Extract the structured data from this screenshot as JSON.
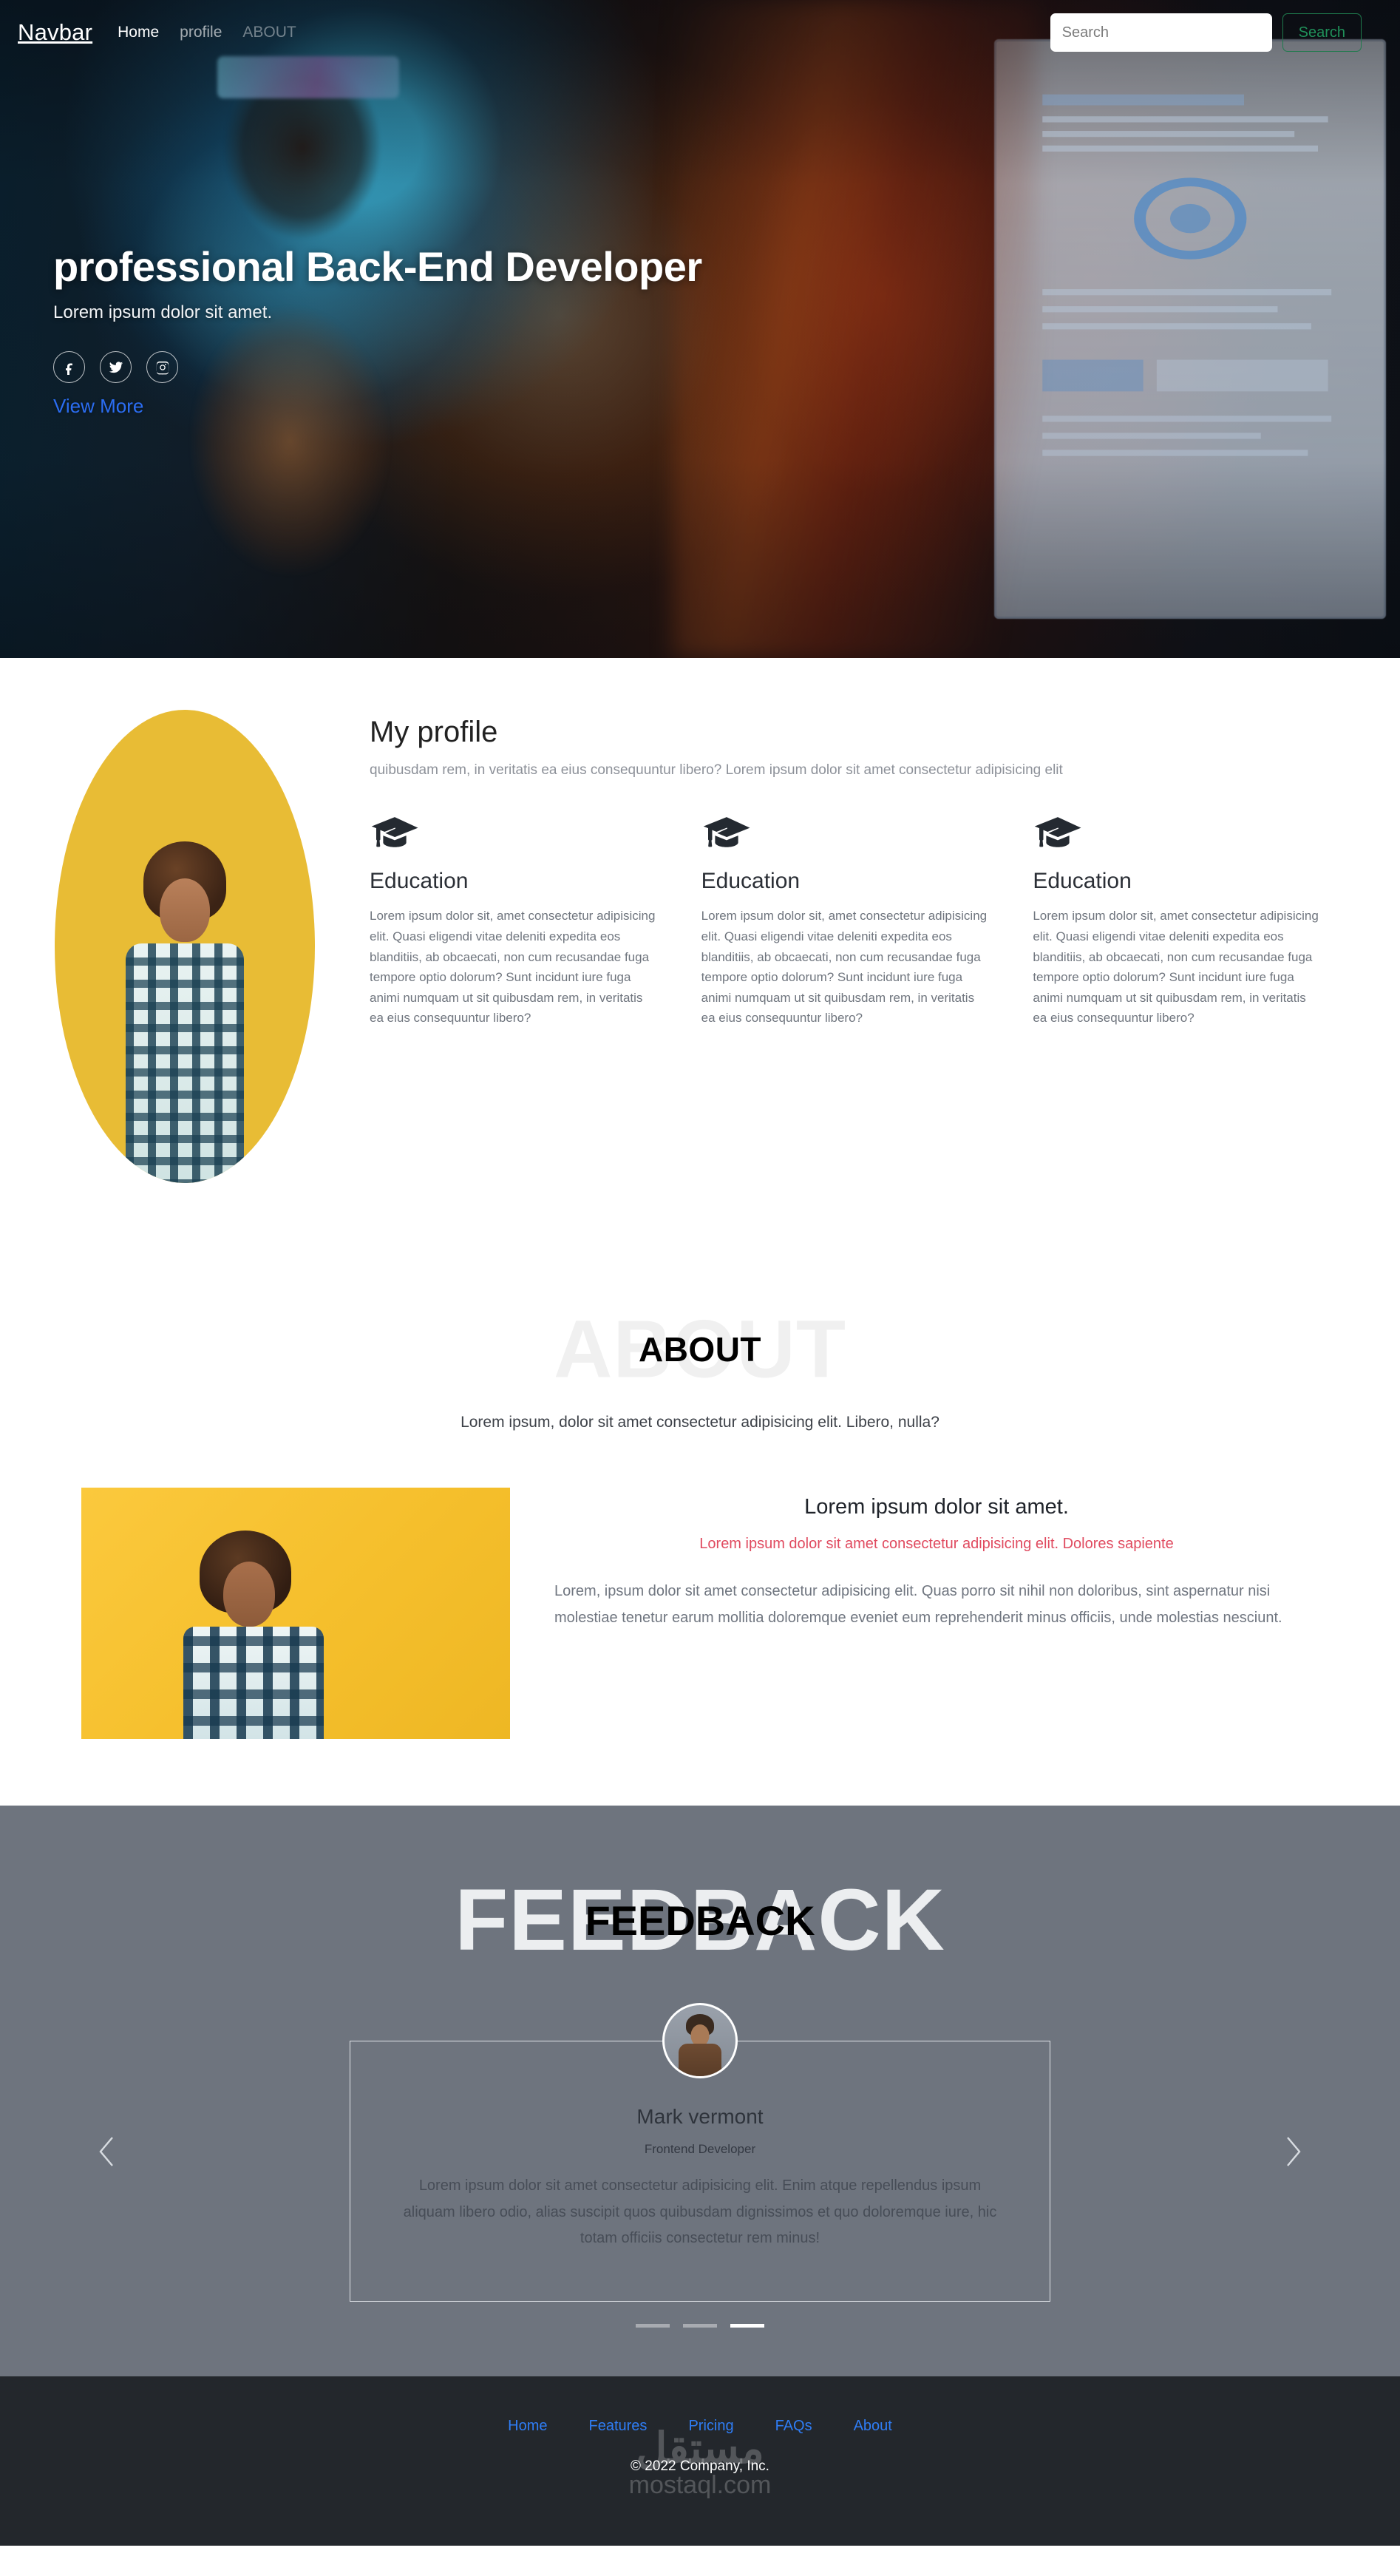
{
  "navbar": {
    "brand": "Navbar",
    "links": [
      {
        "label": "Home",
        "state": "active"
      },
      {
        "label": "profile",
        "state": "normal"
      },
      {
        "label": "ABOUT",
        "state": "muted"
      }
    ],
    "search": {
      "placeholder": "Search",
      "value": "",
      "button_label": "Search",
      "button_color": "#20915a"
    }
  },
  "hero": {
    "title": "professional Back-End Developer",
    "subtitle": "Lorem ipsum dolor sit amet.",
    "socials": [
      {
        "name": "facebook-icon"
      },
      {
        "name": "twitter-icon"
      },
      {
        "name": "instagram-icon"
      }
    ],
    "cta_label": "View More",
    "cta_color": "#2b6df2"
  },
  "profile": {
    "title": "My profile",
    "lead": "quibusdam rem, in veritatis ea eius consequuntur libero? Lorem ipsum dolor sit amet consectetur adipisicing elit",
    "avatar_bg": "#e8bc35",
    "education": [
      {
        "icon": "graduation-cap-icon",
        "title": "Education",
        "body": "Lorem ipsum dolor sit, amet consectetur adipisicing elit. Quasi eligendi vitae deleniti expedita eos blanditiis, ab obcaecati, non cum recusandae fuga tempore optio dolorum? Sunt incidunt iure fuga animi numquam ut sit quibusdam rem, in veritatis ea eius consequuntur libero?"
      },
      {
        "icon": "graduation-cap-icon",
        "title": "Education",
        "body": "Lorem ipsum dolor sit, amet consectetur adipisicing elit. Quasi eligendi vitae deleniti expedita eos blanditiis, ab obcaecati, non cum recusandae fuga tempore optio dolorum? Sunt incidunt iure fuga animi numquam ut sit quibusdam rem, in veritatis ea eius consequuntur libero?"
      },
      {
        "icon": "graduation-cap-icon",
        "title": "Education",
        "body": "Lorem ipsum dolor sit, amet consectetur adipisicing elit. Quasi eligendi vitae deleniti expedita eos blanditiis, ab obcaecati, non cum recusandae fuga tempore optio dolorum? Sunt incidunt iure fuga animi numquam ut sit quibusdam rem, in veritatis ea eius consequuntur libero?"
      }
    ]
  },
  "about": {
    "heading_back": "ABOUT",
    "heading_front": "ABOUT",
    "lead": "Lorem ipsum, dolor sit amet consectetur adipisicing elit. Libero, nulla?",
    "image_bg": "#f5bf2c",
    "title": "Lorem ipsum dolor sit amet.",
    "subtitle": "Lorem ipsum dolor sit amet consectetur adipisicing elit. Dolores sapiente",
    "subtitle_color": "#e04a5f",
    "paragraph": "Lorem, ipsum dolor sit amet consectetur adipisicing elit. Quas porro sit nihil non doloribus, sint aspernatur nisi molestiae tenetur earum mollitia doloremque eveniet eum reprehenderit minus officiis, unde molestias nesciunt."
  },
  "feedback": {
    "heading_back": "FEEDBACK",
    "heading_front": "FEEDBACK",
    "section_bg": "#6e747e",
    "prev_label": "‹",
    "next_label": "›",
    "testimonial": {
      "name": "Mark vermont",
      "role": "Frontend Developer",
      "quote": "Lorem ipsum dolor sit amet consectetur adipisicing elit. Enim atque repellendus ipsum aliquam libero odio, alias suscipit quos quibusdam dignissimos et quo doloremque iure, hic totam officiis consectetur rem minus!"
    },
    "indicators": [
      {
        "active": false
      },
      {
        "active": false
      },
      {
        "active": true
      }
    ]
  },
  "footer": {
    "bg": "#23272c",
    "links": [
      {
        "label": "Home"
      },
      {
        "label": "Features"
      },
      {
        "label": "Pricing"
      },
      {
        "label": "FAQs"
      },
      {
        "label": "About"
      }
    ],
    "link_color": "#2f7df5",
    "copyright": "© 2022 Company, Inc.",
    "watermark_arabic": "مستقل",
    "watermark_latin": "mostaql.com"
  }
}
